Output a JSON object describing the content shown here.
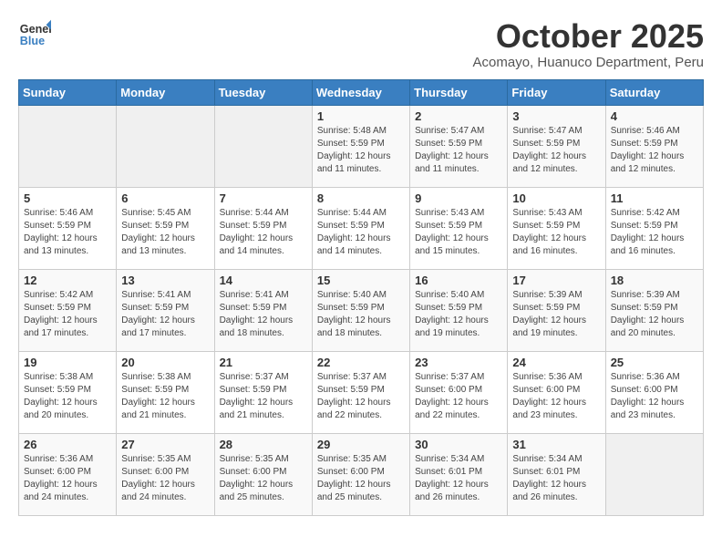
{
  "header": {
    "logo_line1": "General",
    "logo_line2": "Blue",
    "month": "October 2025",
    "location": "Acomayo, Huanuco Department, Peru"
  },
  "weekdays": [
    "Sunday",
    "Monday",
    "Tuesday",
    "Wednesday",
    "Thursday",
    "Friday",
    "Saturday"
  ],
  "weeks": [
    [
      {
        "day": "",
        "info": ""
      },
      {
        "day": "",
        "info": ""
      },
      {
        "day": "",
        "info": ""
      },
      {
        "day": "1",
        "info": "Sunrise: 5:48 AM\nSunset: 5:59 PM\nDaylight: 12 hours\nand 11 minutes."
      },
      {
        "day": "2",
        "info": "Sunrise: 5:47 AM\nSunset: 5:59 PM\nDaylight: 12 hours\nand 11 minutes."
      },
      {
        "day": "3",
        "info": "Sunrise: 5:47 AM\nSunset: 5:59 PM\nDaylight: 12 hours\nand 12 minutes."
      },
      {
        "day": "4",
        "info": "Sunrise: 5:46 AM\nSunset: 5:59 PM\nDaylight: 12 hours\nand 12 minutes."
      }
    ],
    [
      {
        "day": "5",
        "info": "Sunrise: 5:46 AM\nSunset: 5:59 PM\nDaylight: 12 hours\nand 13 minutes."
      },
      {
        "day": "6",
        "info": "Sunrise: 5:45 AM\nSunset: 5:59 PM\nDaylight: 12 hours\nand 13 minutes."
      },
      {
        "day": "7",
        "info": "Sunrise: 5:44 AM\nSunset: 5:59 PM\nDaylight: 12 hours\nand 14 minutes."
      },
      {
        "day": "8",
        "info": "Sunrise: 5:44 AM\nSunset: 5:59 PM\nDaylight: 12 hours\nand 14 minutes."
      },
      {
        "day": "9",
        "info": "Sunrise: 5:43 AM\nSunset: 5:59 PM\nDaylight: 12 hours\nand 15 minutes."
      },
      {
        "day": "10",
        "info": "Sunrise: 5:43 AM\nSunset: 5:59 PM\nDaylight: 12 hours\nand 16 minutes."
      },
      {
        "day": "11",
        "info": "Sunrise: 5:42 AM\nSunset: 5:59 PM\nDaylight: 12 hours\nand 16 minutes."
      }
    ],
    [
      {
        "day": "12",
        "info": "Sunrise: 5:42 AM\nSunset: 5:59 PM\nDaylight: 12 hours\nand 17 minutes."
      },
      {
        "day": "13",
        "info": "Sunrise: 5:41 AM\nSunset: 5:59 PM\nDaylight: 12 hours\nand 17 minutes."
      },
      {
        "day": "14",
        "info": "Sunrise: 5:41 AM\nSunset: 5:59 PM\nDaylight: 12 hours\nand 18 minutes."
      },
      {
        "day": "15",
        "info": "Sunrise: 5:40 AM\nSunset: 5:59 PM\nDaylight: 12 hours\nand 18 minutes."
      },
      {
        "day": "16",
        "info": "Sunrise: 5:40 AM\nSunset: 5:59 PM\nDaylight: 12 hours\nand 19 minutes."
      },
      {
        "day": "17",
        "info": "Sunrise: 5:39 AM\nSunset: 5:59 PM\nDaylight: 12 hours\nand 19 minutes."
      },
      {
        "day": "18",
        "info": "Sunrise: 5:39 AM\nSunset: 5:59 PM\nDaylight: 12 hours\nand 20 minutes."
      }
    ],
    [
      {
        "day": "19",
        "info": "Sunrise: 5:38 AM\nSunset: 5:59 PM\nDaylight: 12 hours\nand 20 minutes."
      },
      {
        "day": "20",
        "info": "Sunrise: 5:38 AM\nSunset: 5:59 PM\nDaylight: 12 hours\nand 21 minutes."
      },
      {
        "day": "21",
        "info": "Sunrise: 5:37 AM\nSunset: 5:59 PM\nDaylight: 12 hours\nand 21 minutes."
      },
      {
        "day": "22",
        "info": "Sunrise: 5:37 AM\nSunset: 5:59 PM\nDaylight: 12 hours\nand 22 minutes."
      },
      {
        "day": "23",
        "info": "Sunrise: 5:37 AM\nSunset: 6:00 PM\nDaylight: 12 hours\nand 22 minutes."
      },
      {
        "day": "24",
        "info": "Sunrise: 5:36 AM\nSunset: 6:00 PM\nDaylight: 12 hours\nand 23 minutes."
      },
      {
        "day": "25",
        "info": "Sunrise: 5:36 AM\nSunset: 6:00 PM\nDaylight: 12 hours\nand 23 minutes."
      }
    ],
    [
      {
        "day": "26",
        "info": "Sunrise: 5:36 AM\nSunset: 6:00 PM\nDaylight: 12 hours\nand 24 minutes."
      },
      {
        "day": "27",
        "info": "Sunrise: 5:35 AM\nSunset: 6:00 PM\nDaylight: 12 hours\nand 24 minutes."
      },
      {
        "day": "28",
        "info": "Sunrise: 5:35 AM\nSunset: 6:00 PM\nDaylight: 12 hours\nand 25 minutes."
      },
      {
        "day": "29",
        "info": "Sunrise: 5:35 AM\nSunset: 6:00 PM\nDaylight: 12 hours\nand 25 minutes."
      },
      {
        "day": "30",
        "info": "Sunrise: 5:34 AM\nSunset: 6:01 PM\nDaylight: 12 hours\nand 26 minutes."
      },
      {
        "day": "31",
        "info": "Sunrise: 5:34 AM\nSunset: 6:01 PM\nDaylight: 12 hours\nand 26 minutes."
      },
      {
        "day": "",
        "info": ""
      }
    ]
  ]
}
